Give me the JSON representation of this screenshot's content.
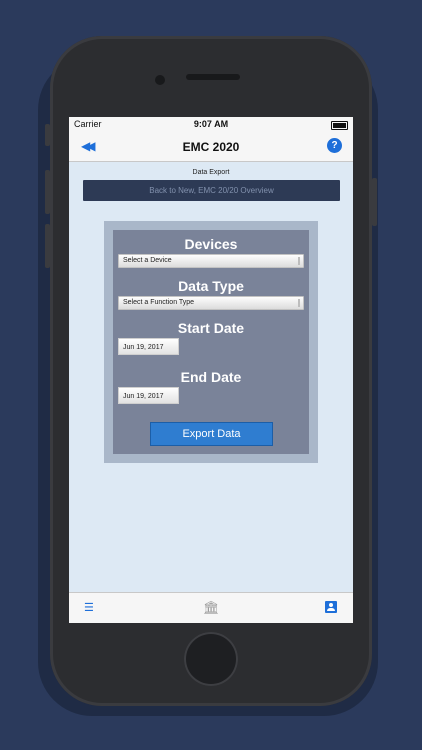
{
  "status": {
    "carrier": "Carrier",
    "time": "9:07 AM"
  },
  "nav": {
    "title": "EMC 2020",
    "back_icon": "rewind-icon",
    "help_label": "?"
  },
  "section": {
    "label": "Data Export"
  },
  "banner": {
    "text": "Back to New, EMC 20/20 Overview"
  },
  "form": {
    "devices_heading": "Devices",
    "devices_select": "Select a Device",
    "datatype_heading": "Data Type",
    "datatype_select": "Select a Function Type",
    "start_heading": "Start Date",
    "start_value": "Jun 19, 2017",
    "end_heading": "End Date",
    "end_value": "Jun 19, 2017",
    "export_label": "Export Data"
  },
  "tabbar": {
    "items": [
      "list-icon",
      "bank-icon",
      "contact-icon"
    ]
  },
  "colors": {
    "accent": "#1e6fd9",
    "background": "#2b3a5c",
    "panel": "#7a8399"
  }
}
